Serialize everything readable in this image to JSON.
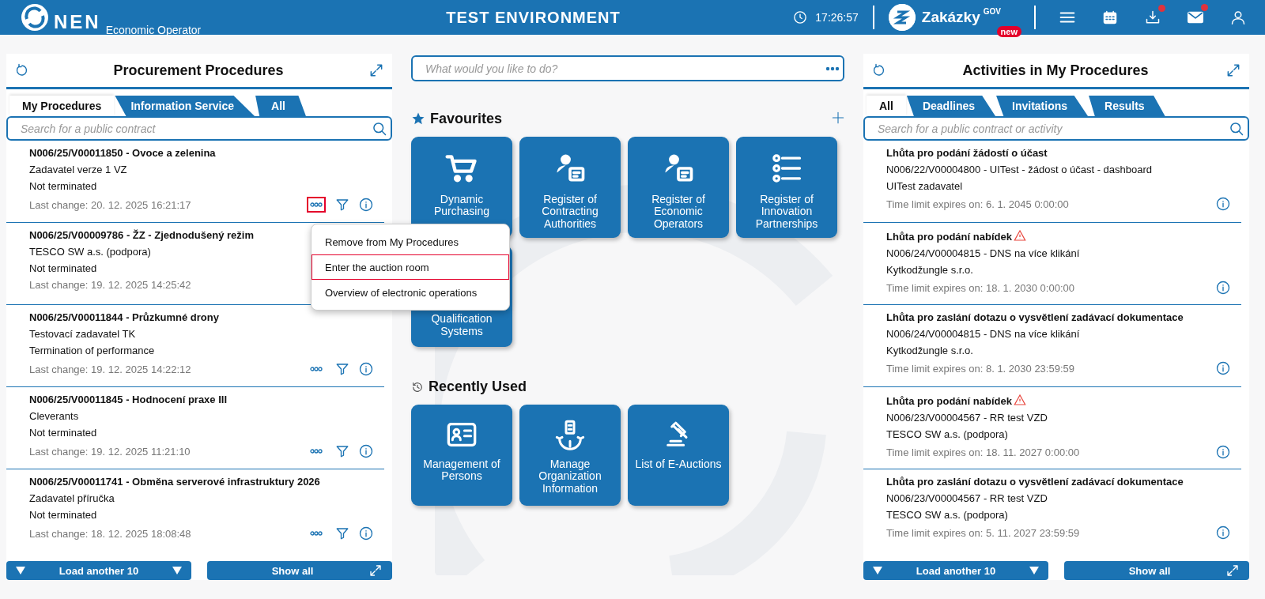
{
  "header": {
    "logo_text": "NEN",
    "subtitle": "Economic Operator",
    "environment": "TEST ENVIRONMENT",
    "time": "17:26:57",
    "zakazky": {
      "name": "Zakázky",
      "sup": "GOV",
      "badge": "new"
    },
    "icons": [
      {
        "kind": "menu",
        "alert": false
      },
      {
        "kind": "calendar",
        "alert": false
      },
      {
        "kind": "download",
        "alert": true
      },
      {
        "kind": "mail",
        "alert": true
      },
      {
        "kind": "user",
        "alert": false
      }
    ]
  },
  "procedures": {
    "title": "Procurement Procedures",
    "tabs": [
      {
        "label": "My Procedures",
        "selected": true
      },
      {
        "label": "Information Service",
        "selected": false
      },
      {
        "label": "All",
        "selected": false
      }
    ],
    "search": {
      "placeholder": "Search for a public contract"
    },
    "items": [
      {
        "title": "N006/25/V00011850 - Ovoce a zelenina",
        "authority": "Zadavatel verze 1 VZ",
        "status": "Not terminated",
        "changed": "Last change: 20. 12. 2025 16:21:17",
        "menu_open": true,
        "actions_covered": false
      },
      {
        "title": "N006/25/V00009786 - ŽZ - Zjednodušený režim",
        "authority": "TESCO SW a.s. (podpora)",
        "status": "Not terminated",
        "changed": "Last change: 19. 12. 2025 14:25:42",
        "actions_covered": true
      },
      {
        "title": "N006/25/V00011844 - Průzkumné drony",
        "authority": "Testovací zadavatel TK",
        "status": "Termination of performance",
        "changed": "Last change: 19. 12. 2025 14:22:12",
        "menu_open": false,
        "actions_covered": false
      },
      {
        "title": "N006/25/V00011845 - Hodnocení praxe III",
        "authority": "Cleverants",
        "status": "Not terminated",
        "changed": "Last change: 19. 12. 2025 11:21:10",
        "menu_open": false,
        "actions_covered": false
      },
      {
        "title": "N006/25/V00011741 - Obměna serverové infrastruktury 2026",
        "authority": "Zadavatel příručka",
        "status": "Not terminated",
        "changed": "Last change: 18. 12. 2025 18:08:48",
        "menu_open": false,
        "actions_covered": false
      }
    ],
    "menu": [
      {
        "label": "Remove from My Procedures",
        "selected": false
      },
      {
        "label": "Enter the auction room",
        "selected": true
      },
      {
        "label": "Overview of electronic operations",
        "selected": false
      }
    ],
    "load_more": "Load another 10",
    "show_all": "Show all"
  },
  "center": {
    "search": {
      "placeholder": "What would you like to do?"
    },
    "favourites": {
      "title": "Favourites",
      "tiles": [
        {
          "kind": "cart",
          "label": "Dynamic Purchasing"
        },
        {
          "kind": "person-card",
          "label": "Register of Contracting Authorities"
        },
        {
          "kind": "person-card",
          "label": "Register of Economic Operators"
        },
        {
          "kind": "list",
          "label": "Register of Innovation Partnerships"
        },
        {
          "kind": "covered",
          "label": "Qualification Systems"
        }
      ]
    },
    "recent": {
      "title": "Recently Used",
      "tiles": [
        {
          "kind": "id-card",
          "label": "Management of Persons"
        },
        {
          "kind": "org",
          "label": "Manage Organization Information"
        },
        {
          "kind": "gavel",
          "label": "List of E-Auctions"
        }
      ]
    }
  },
  "activities": {
    "title": "Activities in My Procedures",
    "tabs": [
      {
        "label": "All",
        "selected": true
      },
      {
        "label": "Deadlines",
        "selected": false
      },
      {
        "label": "Invitations",
        "selected": false
      },
      {
        "label": "Results",
        "selected": false
      }
    ],
    "search": {
      "placeholder": "Search for a public contract or activity"
    },
    "items": [
      {
        "title": "Lhůta pro podání žádostí o účast",
        "warning": false,
        "contract": "N006/22/V00004800 - UITest - žádost o účast - dashboard",
        "authority": "UITest zadavatel",
        "limit": "Time limit expires on: 6. 1. 2045 0:00:00"
      },
      {
        "title": "Lhůta pro podání nabídek",
        "warning": true,
        "contract": "N006/24/V00004815 - DNS na více klikání",
        "authority": "Kytkodžungle s.r.o.",
        "limit": "Time limit expires on: 18. 1. 2030 0:00:00"
      },
      {
        "title": "Lhůta pro zaslání dotazu o vysvětlení zadávací dokumentace",
        "warning": false,
        "contract": "N006/24/V00004815 - DNS na více klikání",
        "authority": "Kytkodžungle s.r.o.",
        "limit": "Time limit expires on: 8. 1. 2030 23:59:59"
      },
      {
        "title": "Lhůta pro podání nabídek",
        "warning": true,
        "contract": "N006/23/V00004567 - RR test VZD",
        "authority": "TESCO SW a.s. (podpora)",
        "limit": "Time limit expires on: 18. 11. 2027 0:00:00"
      },
      {
        "title": "Lhůta pro zaslání dotazu o vysvětlení zadávací dokumentace",
        "warning": false,
        "contract": "N006/23/V00004567 - RR test VZD",
        "authority": "TESCO SW a.s. (podpora)",
        "limit": "Time limit expires on: 5. 11. 2027 23:59:59"
      }
    ],
    "load_more": "Load another 10",
    "show_all": "Show all"
  }
}
